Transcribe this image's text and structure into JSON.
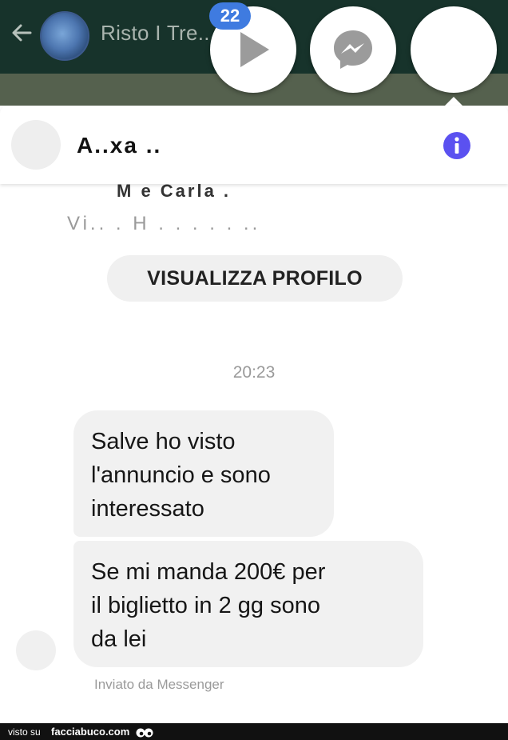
{
  "background_app": {
    "title": "Risto I Tre...",
    "group_avatar": "group-avatar"
  },
  "chat_heads": {
    "badge_count": "22",
    "icons": [
      "play-icon",
      "messenger-icon",
      "blank-avatar"
    ]
  },
  "conversation": {
    "contact_name": "A..xa ..",
    "profile_line1": "M       e Carla .",
    "profile_line2": "Vi..  . H . . . . . ..",
    "view_profile_button": "VISUALIZZA PROFILO",
    "timestamp": "20:23",
    "messages": [
      {
        "lines": [
          "Salve ho visto",
          "l'annuncio e sono",
          "interessato"
        ]
      },
      {
        "lines": [
          "Se mi manda 200€ per",
          "il biglietto in 2 gg sono",
          "da lei"
        ]
      }
    ],
    "sent_via": "Inviato da Messenger"
  },
  "footer": {
    "prefix": "visto su",
    "brand": "facciabuco.com"
  },
  "colors": {
    "appbar": "#17332b",
    "badge": "#3f7be0",
    "info_icon": "#5b51f0",
    "bubble": "#f1f1f1"
  }
}
